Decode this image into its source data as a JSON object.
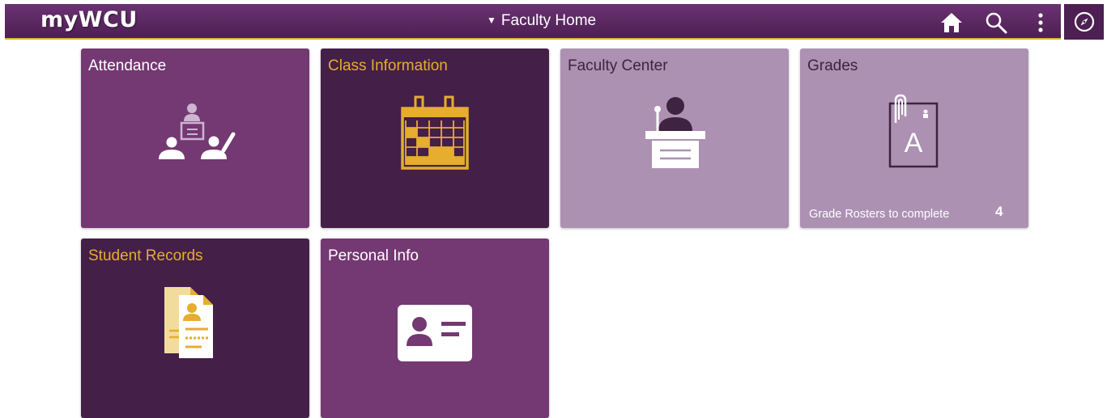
{
  "header": {
    "logo": "myWCU",
    "page_selector": "Faculty Home",
    "icons": [
      "home-icon",
      "search-icon",
      "more-options-icon",
      "navbar-compass-icon"
    ]
  },
  "colors": {
    "banner": "#5c2a62",
    "accent_gold": "#e6ad2e",
    "tile_medium": "#743872",
    "tile_dark": "#441f48",
    "tile_light": "#ac91b3"
  },
  "tiles": [
    {
      "title": "Attendance",
      "icon": "attendance-classroom-icon"
    },
    {
      "title": "Class Information",
      "icon": "calendar-icon"
    },
    {
      "title": "Faculty Center",
      "icon": "podium-speaker-icon"
    },
    {
      "title": "Grades",
      "icon": "graded-paper-icon",
      "metric_label": "Grade Rosters to complete",
      "metric_value": "4"
    },
    {
      "title": "Student Records",
      "icon": "student-records-icon"
    },
    {
      "title": "Personal Info",
      "icon": "id-card-icon"
    }
  ]
}
